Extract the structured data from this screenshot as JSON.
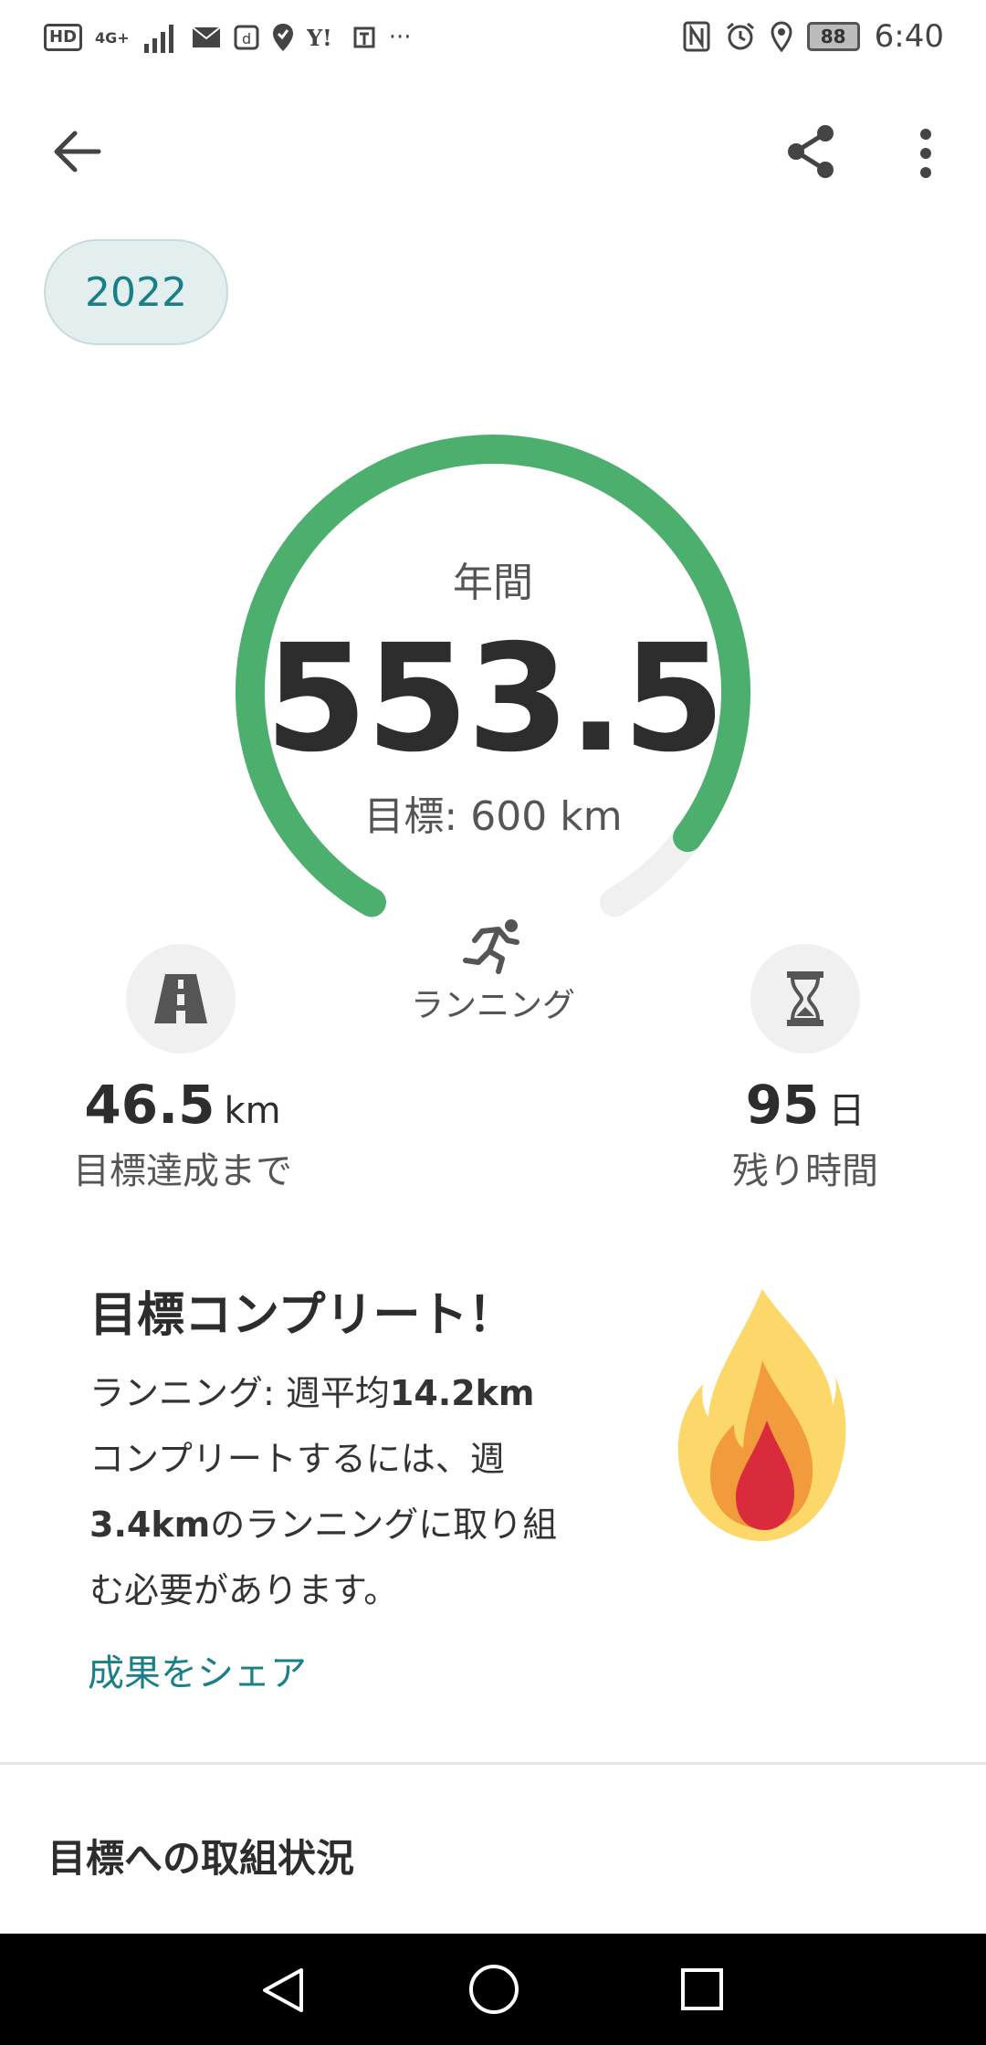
{
  "status_bar": {
    "hd": "HD",
    "network": "4G+",
    "more": "···",
    "battery": "88",
    "time": "6:40"
  },
  "app_bar": {
    "back_icon": "arrow-left-icon",
    "share_icon": "share-icon",
    "more_icon": "more-vert-icon"
  },
  "year": "2022",
  "goal_ring": {
    "label": "年間",
    "value": "553.5",
    "goal_text": "目標: 600 km",
    "progress_fraction": 0.9225,
    "activity_icon": "running-icon",
    "activity_label": "ランニング",
    "color": "#4caf6d",
    "track_color": "#f0f0f0"
  },
  "stats": {
    "remaining_distance": {
      "icon": "road-icon",
      "value": "46.5",
      "unit": "km",
      "caption": "目標達成まで"
    },
    "remaining_time": {
      "icon": "hourglass-icon",
      "value": "95",
      "unit": "日",
      "caption": "残り時間"
    }
  },
  "goal_complete": {
    "title": "目標コンプリート！",
    "line1_prefix": "ランニング: 週平均",
    "line1_bold": "14.2km",
    "line2": "コンプリートするには、週",
    "line3_bold": "3.4km",
    "line3_rest": "のランニングに取り組",
    "line4": "む必要があります。",
    "share_link": "成果をシェア",
    "flame_icon": "flame-icon"
  },
  "progress_section": {
    "title": "目標への取組状況"
  },
  "accent_color": "#1a7f86"
}
